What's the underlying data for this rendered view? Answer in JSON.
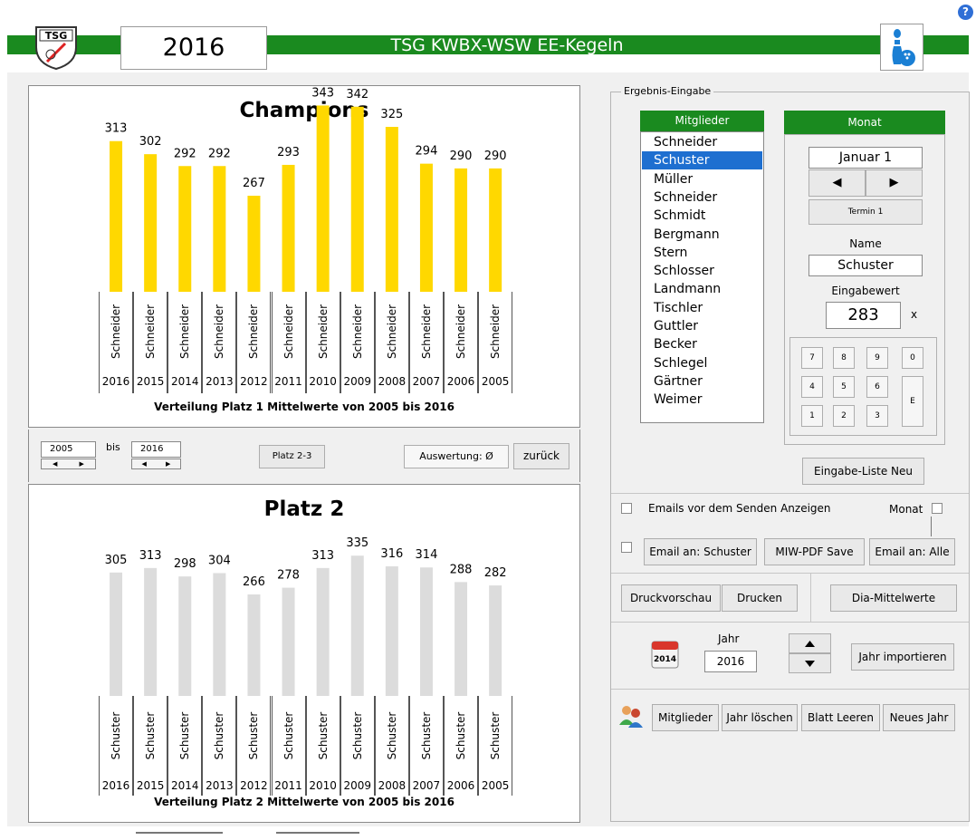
{
  "header": {
    "year": "2016",
    "title": "TSG KWBX-WSW EE-Kegeln",
    "logo_text": "TSG"
  },
  "charts": {
    "champions": {
      "title": "Champions",
      "subtitle": "Verteilung Platz 1 Mittelwerte von 2005 bis 2016",
      "bar_color": "#ffd800"
    },
    "platz2": {
      "title": "Platz 2",
      "subtitle": "Verteilung Platz 2 Mittelwerte von 2005 bis 2016",
      "bar_color": "#dcdcdc"
    }
  },
  "chart_data": [
    {
      "type": "bar",
      "title": "Champions",
      "subtitle": "Verteilung Platz 1 Mittelwerte von 2005 bis 2016",
      "categories": [
        "2016",
        "2015",
        "2014",
        "2013",
        "2012",
        "2011",
        "2010",
        "2009",
        "2008",
        "2007",
        "2006",
        "2005"
      ],
      "names": [
        "Schneider",
        "Schneider",
        "Schneider",
        "Schneider",
        "Schneider",
        "Schneider",
        "Schneider",
        "Schneider",
        "Schneider",
        "Schneider",
        "Schneider",
        "Schneider"
      ],
      "values": [
        313,
        302,
        292,
        292,
        267,
        293,
        343,
        342,
        325,
        294,
        290,
        290
      ],
      "grid": false
    },
    {
      "type": "bar",
      "title": "Platz 2",
      "subtitle": "Verteilung Platz 2 Mittelwerte von 2005 bis 2016",
      "categories": [
        "2016",
        "2015",
        "2014",
        "2013",
        "2012",
        "2011",
        "2010",
        "2009",
        "2008",
        "2007",
        "2006",
        "2005"
      ],
      "names": [
        "Schuster",
        "Schuster",
        "Schuster",
        "Schuster",
        "Schuster",
        "Schuster",
        "Schuster",
        "Schuster",
        "Schuster",
        "Schuster",
        "Schuster",
        "Schuster"
      ],
      "values": [
        305,
        313,
        298,
        304,
        266,
        278,
        313,
        335,
        316,
        314,
        288,
        282
      ],
      "grid": false
    }
  ],
  "range": {
    "from": "2005",
    "bis_label": "bis",
    "to": "2016",
    "platz_button": "Platz 2-3",
    "auswertung_button": "Auswertung: Ø",
    "back_button": "zurück"
  },
  "entry": {
    "frame_title": "Ergebnis-Eingabe",
    "members_header": "Mitglieder",
    "members": [
      "Schneider",
      "Schuster",
      "Müller",
      "Schneider",
      "Schmidt",
      "Bergmann",
      "Stern",
      "Schlosser",
      "Landmann",
      "Tischler",
      "Guttler",
      "Becker",
      "Schlegel",
      "Gärtner",
      "Weimer"
    ],
    "selected_member_index": 1,
    "monat_header": "Monat",
    "month_value": "Januar 1",
    "prev_icon": "◀",
    "next_icon": "▶",
    "termin_button": "Termin 1",
    "name_label": "Name",
    "name_value": "Schuster",
    "eingabewert_label": "Eingabewert",
    "eingabewert_value": "283",
    "x_label": "x",
    "keys": [
      "7",
      "8",
      "9",
      "0",
      "4",
      "5",
      "6",
      "1",
      "2",
      "3"
    ],
    "enter_key": "E",
    "new_list_button": "Eingabe-Liste Neu"
  },
  "email": {
    "show_before_send_label": "Emails vor dem Senden Anzeigen",
    "monat_label": "Monat",
    "email_member_button": "Email an: Schuster",
    "pdf_button": "MIW-PDF Save",
    "email_all_button": "Email an: Alle"
  },
  "print": {
    "preview_button": "Druckvorschau",
    "print_button": "Drucken",
    "dia_button": "Dia-Mittelwerte"
  },
  "jahr": {
    "label": "Jahr",
    "value": "2016",
    "calendar_text": "2014",
    "import_button": "Jahr importieren"
  },
  "bottom": {
    "members_button": "Mitglieder",
    "delete_year_button": "Jahr löschen",
    "clear_sheet_button": "Blatt Leeren",
    "new_year_button": "Neues Jahr"
  }
}
